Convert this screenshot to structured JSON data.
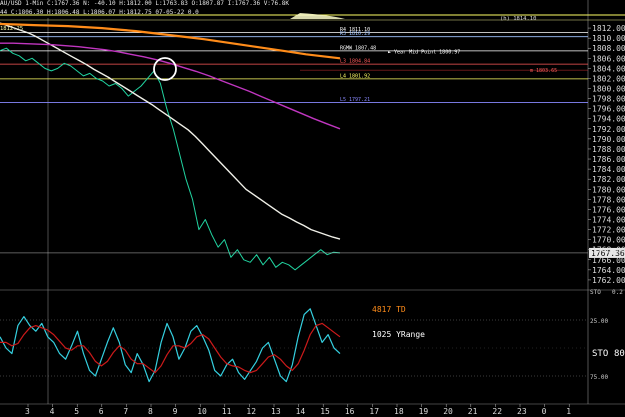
{
  "header": {
    "line1": "AU/USD 1-Min  C:1767.36  N: -40.10  H:1812.00  L:1763.83  O:1807.87  I:1767.36  V:76.8K",
    "line2": "44  C:1806.30  H:1806.48  L:1806.07  H:1812.75  07-05-22  0.0"
  },
  "pivots": [
    {
      "label": "R4  1811.10",
      "value": 1811.1,
      "color": "#ffffff"
    },
    {
      "label": "R3  1810.29",
      "value": 1810.29,
      "color": "#9fc4ff"
    },
    {
      "label": "RGMW  1807.48",
      "value": 1807.48,
      "color": "#ffffff"
    },
    {
      "label": "L3  1804.84",
      "value": 1804.84,
      "color": "#ff5a5a"
    },
    {
      "label": "L4  1801.92",
      "value": 1801.92,
      "color": "#ffff66"
    },
    {
      "label": "L5  1797.21",
      "value": 1797.21,
      "color": "#8a8aff"
    }
  ],
  "annotations": {
    "year_mid": "► Year Mid Point  1800.97",
    "top_left_level": "1812.25",
    "top_right_level": "(h) 1814.10",
    "red_level": "m  1803.65",
    "stoch_label": "STO",
    "stoch_value": "80",
    "td_label": "4817 TD",
    "yrange_label": "1025 YRange",
    "sto_axis_label": "STO",
    "sto_axis_value": "0.2"
  },
  "chart_data": [
    {
      "type": "line",
      "series": [
        {
          "values": [
            1807.5,
            1808,
            1807,
            1806.5,
            1805.5,
            1806,
            1805,
            1804,
            1803.5,
            1804,
            1805,
            1804.5,
            1803.5,
            1802.5,
            1803,
            1802,
            1801.5,
            1800.5,
            1801,
            1800,
            1798.5,
            1799.5,
            1800.5,
            1802,
            1803.5,
            1801,
            1796,
            1792,
            1787,
            1782,
            1778,
            1772,
            1774,
            1771,
            1768.5,
            1770,
            1766.5,
            1768,
            1766,
            1765.5,
            1767,
            1765,
            1766.5,
            1764.5,
            1765.5,
            1765,
            1764,
            1765,
            1766,
            1767,
            1768,
            1767,
            1767.5,
            1767.36
          ],
          "color": "#21d3a0"
        },
        {
          "values": [
            1813,
            1812.5,
            1812,
            1811.5,
            1811,
            1810.3,
            1809.5,
            1808.7,
            1807.9,
            1807.1,
            1806.3,
            1805.5,
            1804.7,
            1803.8,
            1803,
            1802.2,
            1801.3,
            1800.4,
            1799.5,
            1798.6,
            1797.7,
            1796.8,
            1795.8,
            1794.8,
            1793.8,
            1792.8,
            1791.8,
            1790.5,
            1789,
            1787.5,
            1786,
            1784.5,
            1783,
            1781.5,
            1780,
            1779,
            1778,
            1777,
            1776,
            1775,
            1774.3,
            1773.5,
            1772.8,
            1772,
            1771.5,
            1771,
            1770.5,
            1770.1
          ],
          "color": "#f0f0e8"
        },
        {
          "values": [
            1809,
            1809,
            1808.9,
            1808.8,
            1808.7,
            1808.5,
            1808.3,
            1808,
            1807.7,
            1807.3,
            1806.8,
            1806.3,
            1805.7,
            1805,
            1804.2,
            1803.4,
            1802.5,
            1801.5,
            1800.5,
            1799.5,
            1798.4,
            1797.3,
            1796.2,
            1795.1,
            1794,
            1793,
            1792
          ],
          "color": "#c036c0"
        },
        {
          "values": [
            1812.8,
            1812.7,
            1812.6,
            1812.5,
            1812.4,
            1812.2,
            1812,
            1811.7,
            1811.4,
            1811,
            1810.6,
            1810.2,
            1809.8,
            1809.3,
            1808.8,
            1808.3,
            1807.8,
            1807.3,
            1806.8,
            1806.4,
            1806
          ],
          "color": "#ff8c1a"
        }
      ],
      "ylim": [
        1760,
        1814
      ],
      "y_ticks": [
        "1812.00",
        "1810.00",
        "1808.00",
        "1806.00",
        "1804.00",
        "1802.00",
        "1800.00",
        "1798.00",
        "1796.00",
        "1794.00",
        "1792.00",
        "1790.00",
        "1788.00",
        "1786.00",
        "1784.00",
        "1782.00",
        "1780.00",
        "1778.00",
        "1776.00",
        "1774.00",
        "1772.00",
        "1770.00",
        "1768.00",
        "1766.00",
        "1764.00",
        "1762.00"
      ],
      "y_tick_values": [
        1812,
        1810,
        1808,
        1806,
        1804,
        1802,
        1800,
        1798,
        1796,
        1794,
        1792,
        1790,
        1788,
        1786,
        1784,
        1782,
        1780,
        1778,
        1776,
        1774,
        1772,
        1770,
        1768,
        1766,
        1764,
        1762
      ],
      "last_price_label": "1767.36",
      "last_price": 1767.36,
      "x_ticks": [
        "3",
        "4",
        "5",
        "6",
        "7",
        "8",
        "9",
        "10",
        "11",
        "12",
        "13",
        "14",
        "15",
        "16",
        "17",
        "18",
        "19",
        "20",
        "21",
        "22",
        "23",
        "0",
        "1"
      ],
      "grid": false
    },
    {
      "type": "line",
      "series": [
        {
          "values": [
            60,
            50,
            45,
            70,
            78,
            70,
            65,
            72,
            60,
            55,
            45,
            40,
            52,
            65,
            45,
            30,
            25,
            40,
            55,
            68,
            55,
            35,
            28,
            45,
            35,
            20,
            30,
            55,
            72,
            60,
            40,
            50,
            65,
            70,
            60,
            48,
            30,
            25,
            35,
            40,
            28,
            22,
            30,
            38,
            50,
            55,
            40,
            25,
            20,
            35,
            60,
            80,
            85,
            70,
            55,
            62,
            50,
            45
          ],
          "color": "#35d0e0"
        },
        {
          "values": [
            55,
            55,
            52,
            54,
            62,
            68,
            70,
            68,
            66,
            62,
            56,
            50,
            48,
            52,
            52,
            46,
            38,
            34,
            38,
            46,
            52,
            48,
            40,
            36,
            36,
            32,
            28,
            34,
            44,
            52,
            52,
            50,
            54,
            60,
            62,
            58,
            50,
            42,
            36,
            34,
            33,
            30,
            28,
            30,
            36,
            42,
            44,
            40,
            34,
            30,
            36,
            48,
            62,
            70,
            72,
            68,
            64,
            60
          ],
          "color": "#cc1a1a"
        }
      ],
      "ylim": [
        0,
        100
      ],
      "y_ticks": [
        "25.00",
        "75.00"
      ],
      "y_tick_values": [
        75,
        25
      ]
    }
  ]
}
